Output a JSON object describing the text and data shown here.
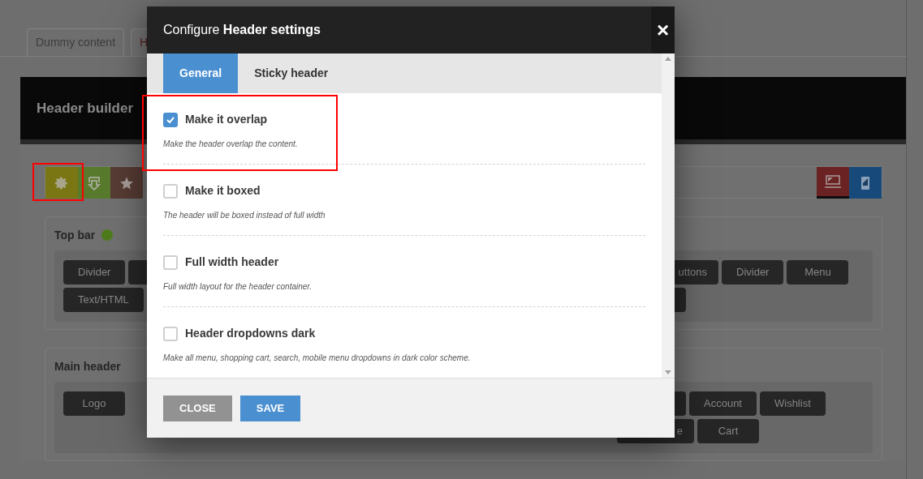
{
  "page": {
    "tabs": [
      {
        "label": "Dummy content",
        "selected": false
      },
      {
        "label": "H",
        "selected": true
      }
    ],
    "builder_title": "Header builder",
    "toolbar": {
      "tools": [
        {
          "kind": "settings"
        },
        {
          "kind": "import"
        },
        {
          "kind": "star"
        }
      ],
      "devices": [
        {
          "kind": "desktop",
          "selected": true
        },
        {
          "kind": "mobile",
          "selected": false
        }
      ]
    },
    "sections": [
      {
        "title": "Top bar",
        "color": "#4f7a1c",
        "left_rows": [
          [
            {
              "label": "Divider"
            },
            {}
          ],
          [
            {
              "label": "Text/HTML"
            }
          ]
        ],
        "right_rows": [
          [
            {
              "label": "uttons",
              "kind": "cut"
            },
            {
              "label": "Divider"
            },
            {
              "label": "Menu"
            }
          ],
          [
            {}
          ]
        ]
      },
      {
        "title": "Main header",
        "left_rows": [
          [
            {
              "label": "Logo"
            }
          ]
        ],
        "right_rows": [
          [
            {},
            {
              "label": "Account"
            },
            {
              "label": "Wishlist"
            }
          ],
          [
            {
              "label": "e",
              "kind": "cut"
            },
            {
              "label": "Cart"
            }
          ]
        ]
      }
    ]
  },
  "dialog": {
    "title": "Configure **Header settings**",
    "close": "×",
    "tabs": [
      {
        "label": "General",
        "selected": true
      },
      {
        "label": "Sticky header",
        "selected": false
      }
    ],
    "options": [
      {
        "label": "Make it overlap",
        "description": "Make the header overlap the content.",
        "checked": true
      },
      {
        "label": "Make it boxed",
        "description": "The header will be boxed instead of full width",
        "checked": false
      },
      {
        "label": "Full width header",
        "description": "Full width layout for the header container.",
        "checked": false
      },
      {
        "label": "Header dropdowns dark",
        "description": "Make all menu, shopping cart, search, mobile menu dropdowns in dark color scheme.",
        "checked": false
      }
    ],
    "buttons": [
      {
        "label": "CLOSE",
        "kind": "secondary"
      },
      {
        "label": "SAVE",
        "kind": "primary"
      }
    ]
  }
}
